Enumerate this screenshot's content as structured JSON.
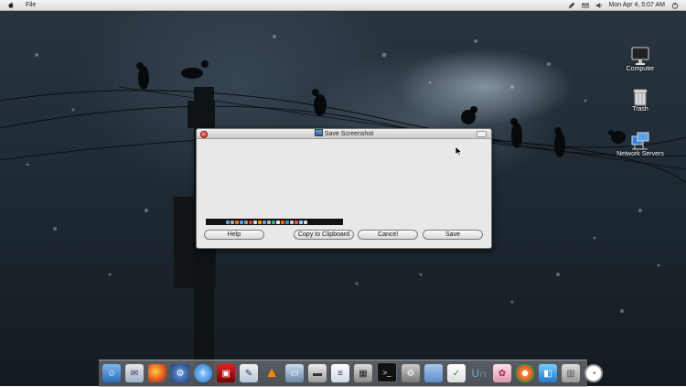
{
  "menubar": {
    "app_menu": "File",
    "clock": "Mon Apr  4,  5:07 AM"
  },
  "desktop": {
    "icons": [
      {
        "label": "Computer"
      },
      {
        "label": "Trash"
      },
      {
        "label": "Network Servers"
      }
    ]
  },
  "dialog": {
    "title": "Save Screenshot",
    "buttons": {
      "help": "Help",
      "copy": "Copy to Clipboard",
      "cancel": "Cancel",
      "save": "Save"
    }
  },
  "dock": {
    "items": [
      "finder",
      "mail",
      "firefox",
      "network",
      "safari",
      "photo-booth",
      "preview",
      "vlc",
      "screenshot",
      "scanner",
      "textedit",
      "calculator",
      "terminal",
      "system-preferences",
      "folder",
      "application",
      "ubuntu-one",
      "office",
      "chrome",
      "vpn",
      "trash",
      "clock"
    ]
  },
  "colors": {
    "menubar": "#e6e6e6",
    "dialog_bg": "#e8e8e8",
    "close_button": "#c8201a",
    "wallpaper": "#1f2a33"
  }
}
